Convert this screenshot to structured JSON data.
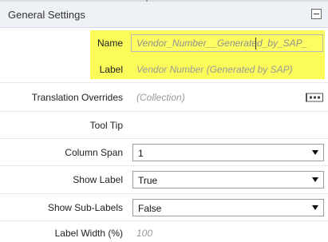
{
  "panel": {
    "title": "General Settings"
  },
  "fields": {
    "name": {
      "label": "Name",
      "value": "Vendor_Number__Generated_by_SAP_"
    },
    "label": {
      "label": "Label",
      "value": "Vendor Number (Generated by SAP)"
    },
    "translation_overrides": {
      "label": "Translation Overrides",
      "value": "(Collection)"
    },
    "tool_tip": {
      "label": "Tool Tip",
      "value": ""
    },
    "column_span": {
      "label": "Column Span",
      "value": "1"
    },
    "show_label": {
      "label": "Show Label",
      "value": "True"
    },
    "show_sub_labels": {
      "label": "Show Sub-Labels",
      "value": "False"
    },
    "label_width": {
      "label": "Label Width (%)",
      "value": "100"
    }
  },
  "colors": {
    "highlight": "#fbfb5a",
    "header_bg": "#eef1f6"
  },
  "icons": {
    "collapse": "collapse-icon",
    "dropdown": "chevron-down-icon",
    "ellipsis": "ellipsis-icon"
  }
}
